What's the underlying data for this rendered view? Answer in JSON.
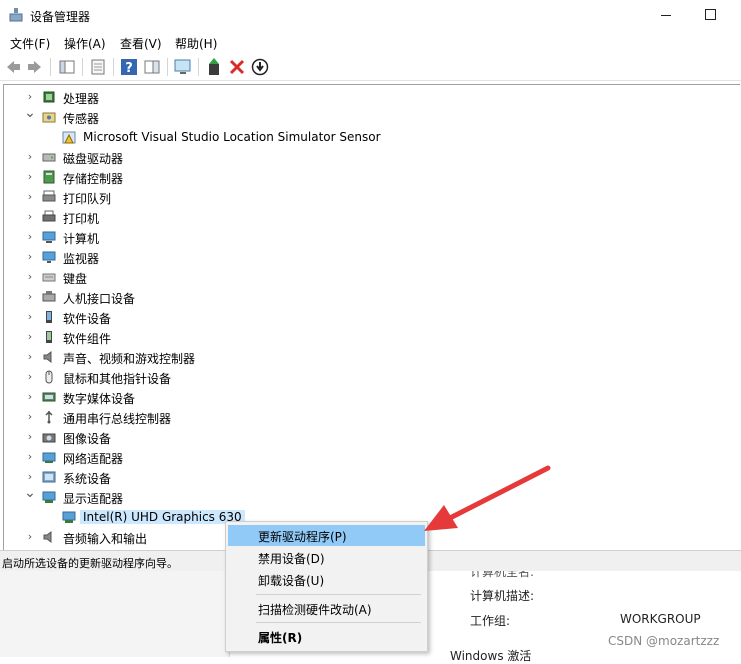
{
  "window": {
    "title": "设备管理器"
  },
  "menu": [
    "文件(F)",
    "操作(A)",
    "查看(V)",
    "帮助(H)"
  ],
  "tree": [
    {
      "label": "处理器",
      "expanded": false,
      "icon": "cpu-icon"
    },
    {
      "label": "传感器",
      "expanded": true,
      "icon": "sensor-icon"
    },
    {
      "label": "Microsoft Visual Studio Location Simulator Sensor",
      "child": true,
      "icon": "warning-sensor-icon"
    },
    {
      "label": "磁盘驱动器",
      "expanded": false,
      "icon": "disk-icon"
    },
    {
      "label": "存储控制器",
      "expanded": false,
      "icon": "storage-controller-icon"
    },
    {
      "label": "打印队列",
      "expanded": false,
      "icon": "print-queue-icon"
    },
    {
      "label": "打印机",
      "expanded": false,
      "icon": "printer-icon"
    },
    {
      "label": "计算机",
      "expanded": false,
      "icon": "computer-icon"
    },
    {
      "label": "监视器",
      "expanded": false,
      "icon": "monitor-icon"
    },
    {
      "label": "键盘",
      "expanded": false,
      "icon": "keyboard-icon"
    },
    {
      "label": "人机接口设备",
      "expanded": false,
      "icon": "hid-icon"
    },
    {
      "label": "软件设备",
      "expanded": false,
      "icon": "software-device-icon"
    },
    {
      "label": "软件组件",
      "expanded": false,
      "icon": "software-component-icon"
    },
    {
      "label": "声音、视频和游戏控制器",
      "expanded": false,
      "icon": "speaker-icon"
    },
    {
      "label": "鼠标和其他指针设备",
      "expanded": false,
      "icon": "mouse-icon"
    },
    {
      "label": "数字媒体设备",
      "expanded": false,
      "icon": "digital-media-icon"
    },
    {
      "label": "通用串行总线控制器",
      "expanded": false,
      "icon": "usb-icon"
    },
    {
      "label": "图像设备",
      "expanded": false,
      "icon": "camera-icon"
    },
    {
      "label": "网络适配器",
      "expanded": false,
      "icon": "network-adapter-icon"
    },
    {
      "label": "系统设备",
      "expanded": false,
      "icon": "system-device-icon"
    },
    {
      "label": "显示适配器",
      "expanded": true,
      "icon": "display-adapter-icon"
    },
    {
      "label": "Intel(R) UHD Graphics 630",
      "child": true,
      "selected": true,
      "icon": "gpu-icon"
    },
    {
      "label": "音频输入和输出",
      "expanded": false,
      "icon": "audio-io-icon"
    }
  ],
  "status": "启动所选设备的更新驱动程序向导。",
  "context_menu": [
    "更新驱动程序(P)",
    "禁用设备(D)",
    "卸载设备(U)",
    "扫描检测硬件改动(A)",
    "属性(R)"
  ],
  "background": {
    "computer_desc_label": "计算机描述:",
    "workgroup_label": "工作组:",
    "workgroup_value": "WORKGROUP",
    "windows_activation": "Windows 激活"
  },
  "watermark": "CSDN @mozartzzz",
  "colors": {
    "highlight": "#91c9f7",
    "selection": "#cce8ff",
    "arrow": "#e63a3a"
  }
}
